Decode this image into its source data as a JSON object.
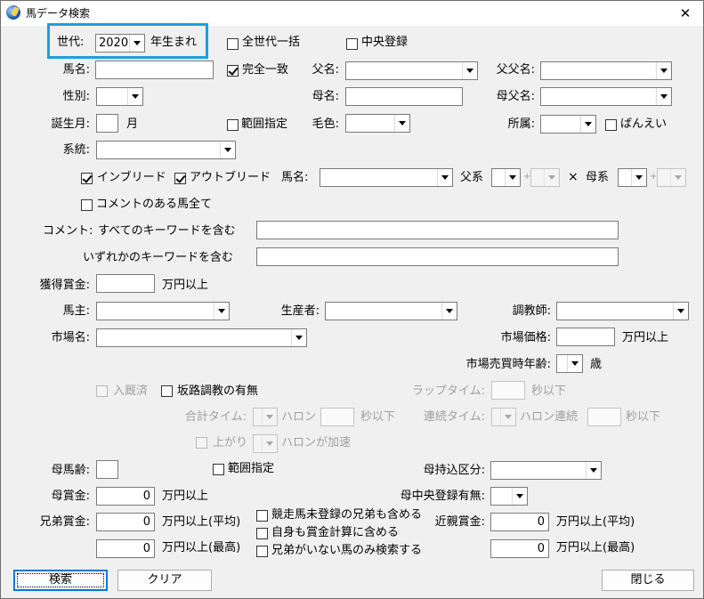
{
  "window": {
    "title": "馬データ検索",
    "close_glyph": "✕"
  },
  "row1": {
    "generation_label": "世代:",
    "generation_value": "2020",
    "generation_suffix": "年生まれ",
    "all_generations_label": "全世代一括",
    "chuo_label": "中央登録"
  },
  "row2": {
    "horse_name_label": "馬名:",
    "horse_name_value": "",
    "exact_match_label": "完全一致",
    "sire_label": "父名:",
    "sire_value": "",
    "grandsire_label": "父父名:",
    "grandsire_value": ""
  },
  "row3": {
    "sex_label": "性別:",
    "dam_label": "母名:",
    "dam_value": "",
    "damsire_label": "母父名:"
  },
  "row4": {
    "birth_month_label": "誕生月:",
    "month_unit": "月",
    "range_label": "範囲指定",
    "coat_label": "毛色:",
    "affiliation_label": "所属:",
    "banei_label": "ばんえい"
  },
  "row5": {
    "lineage_label": "系統:"
  },
  "row6": {
    "inbreed_label": "インブリード",
    "outbreed_label": "アウトブリード",
    "horse_name_label": "馬名:",
    "sire_line_label": "父系",
    "plus": "+",
    "times": "×",
    "dam_line_label": "母系"
  },
  "row7": {
    "comment_only_label": "コメントのある馬全て"
  },
  "row8": {
    "comment_label": "コメント:",
    "all_keywords_label": "すべてのキーワードを含む",
    "any_keywords_label": "いずれかのキーワードを含む"
  },
  "prize": {
    "label": "獲得賞金:",
    "unit": "万円以上"
  },
  "people": {
    "owner_label": "馬主:",
    "breeder_label": "生産者:",
    "trainer_label": "調教師:"
  },
  "market": {
    "market_name_label": "市場名:",
    "market_price_label": "市場価格:",
    "price_unit": "万円以上",
    "market_age_label": "市場売買時年齢:",
    "age_unit": "歳"
  },
  "training": {
    "stabled_label": "入厩済",
    "slope_label": "坂路調教の有無",
    "lap_time_label": "ラップタイム:",
    "seconds_or_less": "秒以下",
    "total_time_label": "合計タイム:",
    "furlong": "ハロン",
    "consecutive_time_label": "連続タイム:",
    "furlong_consecutive": "ハロン連続",
    "rising_label": "上がり",
    "furlong_accelerating": "ハロンが加速"
  },
  "dam": {
    "dam_age_label": "母馬齢:",
    "range_label": "範囲指定",
    "dam_import_label": "母持込区分:",
    "dam_prize_label": "母賞金:",
    "dam_prize_value": "0",
    "unit_over": "万円以上",
    "dam_chuo_label": "母中央登録有無:"
  },
  "sibling": {
    "label": "兄弟賞金:",
    "avg_value": "0",
    "avg_unit": "万円以上(平均)",
    "max_value": "0",
    "max_unit": "万円以上(最高)",
    "opt1": "競走馬未登録の兄弟も含める",
    "opt2": "自身も賞金計算に含める",
    "opt3": "兄弟がいない馬のみ検索する",
    "relative_label": "近親賞金:",
    "rel_avg_value": "0",
    "rel_avg_unit": "万円以上(平均)",
    "rel_max_value": "0",
    "rel_max_unit": "万円以上(最高)"
  },
  "buttons": {
    "search": "検索",
    "clear": "クリア",
    "close": "閉じる"
  },
  "colors": {
    "highlight": "#1aa0de",
    "focus_border": "#0078d7"
  },
  "icons": {
    "app": "horse-globe-icon",
    "close": "close-icon",
    "dropdown": "chevron-down-icon"
  }
}
